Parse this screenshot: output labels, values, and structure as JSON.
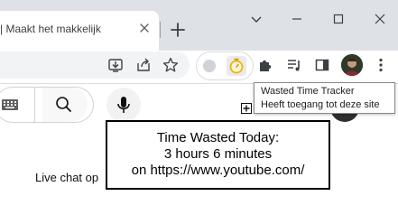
{
  "browser": {
    "tab": {
      "title": "| Maakt het makkelijk"
    },
    "window_controls": {
      "tab_search": "chevron-down-icon",
      "minimize": "minimize-icon",
      "maximize": "maximize-icon",
      "close": "close-icon"
    },
    "toolbar": {
      "icons": [
        "install-icon",
        "share-icon",
        "bookmark-star-icon",
        "extension-small-icon",
        "stopwatch-icon",
        "puzzle-icon",
        "media-queue-icon",
        "side-panel-icon",
        "profile-avatar",
        "more-menu-icon"
      ]
    },
    "tooltip": {
      "title": "Wasted Time Tracker",
      "subtitle": "Heeft toegang tot deze site"
    }
  },
  "page": {
    "live_chat": "Live chat op"
  },
  "popup": {
    "line1": "Time Wasted Today:",
    "line2": "3 hours 6 minutes",
    "line3": "on https://www.youtube.com/"
  },
  "colors": {
    "tabstrip_bg": "#dee1e6",
    "toolbar_bg": "#ffffff",
    "popup_border": "#000000",
    "stopwatch_accent": "#f2b200"
  }
}
